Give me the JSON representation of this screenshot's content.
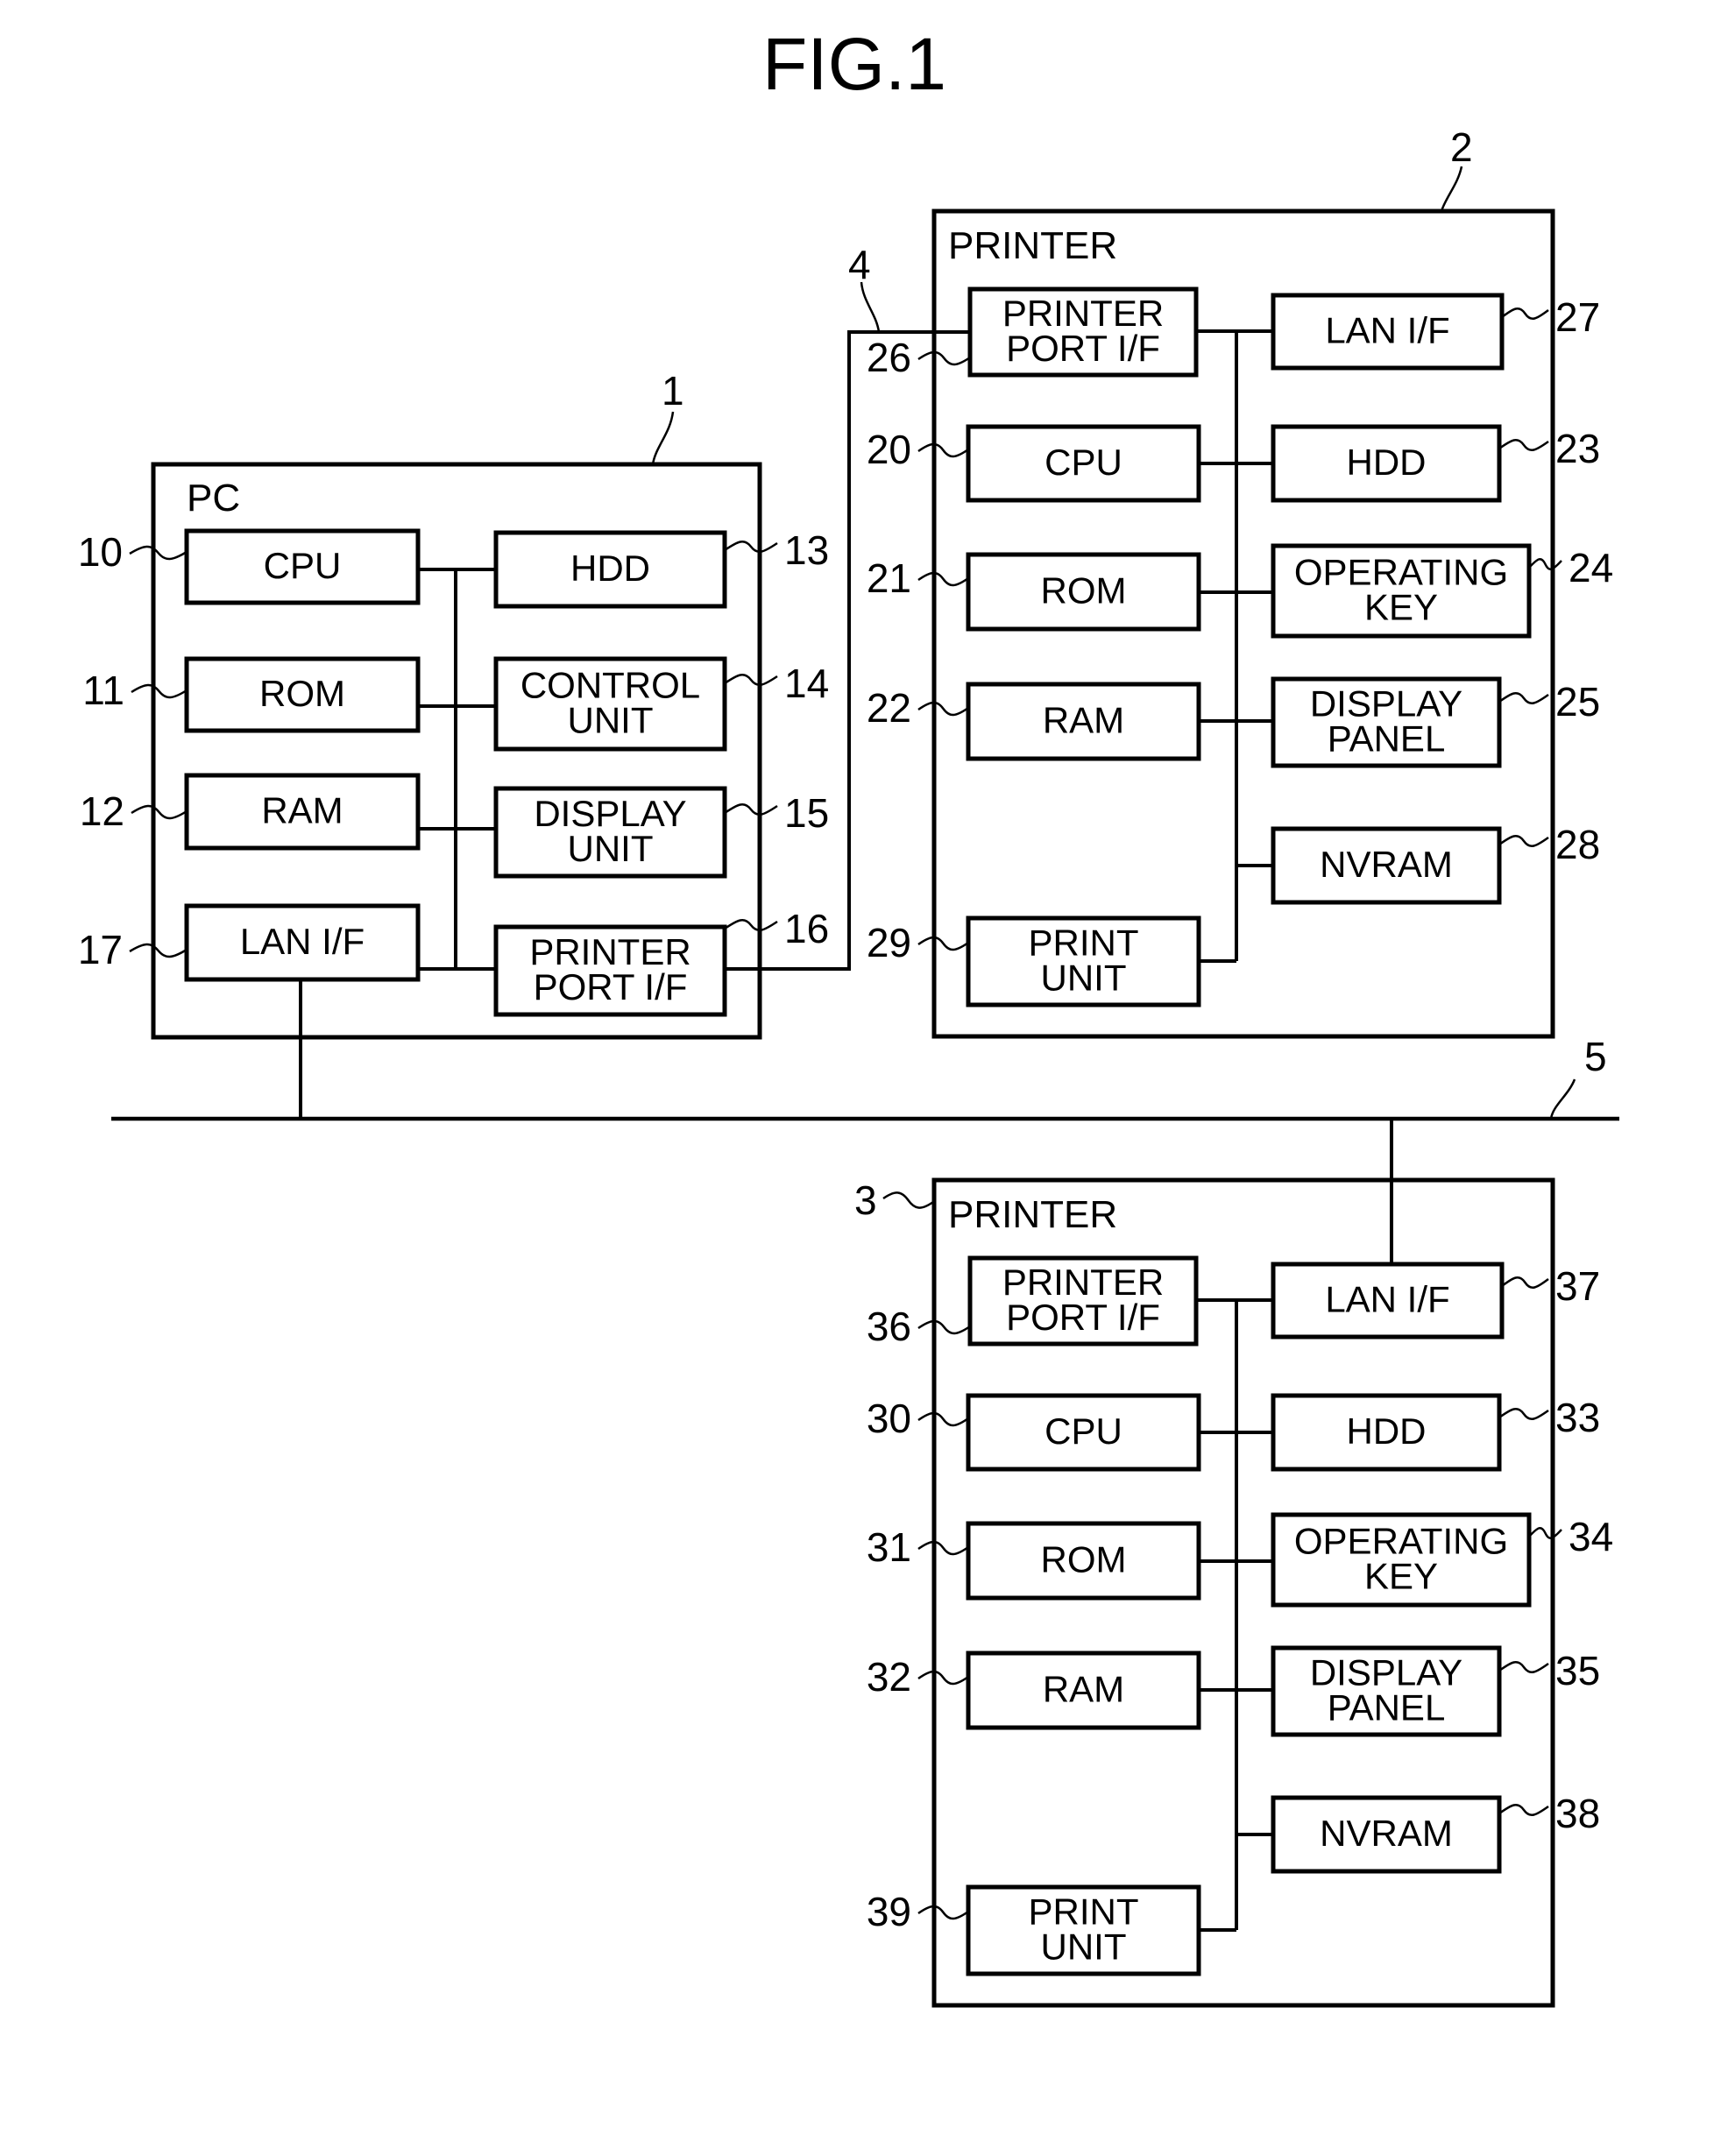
{
  "figure": {
    "title": "FIG.1"
  },
  "pc": {
    "ref": "1",
    "header": "PC",
    "blocks": {
      "cpu": {
        "ref": "10",
        "lines": [
          "CPU"
        ]
      },
      "rom": {
        "ref": "11",
        "lines": [
          "ROM"
        ]
      },
      "ram": {
        "ref": "12",
        "lines": [
          "RAM"
        ]
      },
      "hdd": {
        "ref": "13",
        "lines": [
          "HDD"
        ]
      },
      "control": {
        "ref": "14",
        "lines": [
          "CONTROL",
          "UNIT"
        ]
      },
      "display": {
        "ref": "15",
        "lines": [
          "DISPLAY",
          "UNIT"
        ]
      },
      "port": {
        "ref": "16",
        "lines": [
          "PRINTER",
          "PORT I/F"
        ]
      },
      "lan": {
        "ref": "17",
        "lines": [
          "LAN I/F"
        ]
      }
    }
  },
  "printer_a": {
    "ref": "2",
    "header": "PRINTER",
    "blocks": {
      "port": {
        "ref": "26",
        "lines": [
          "PRINTER",
          "PORT I/F"
        ]
      },
      "cpu": {
        "ref": "20",
        "lines": [
          "CPU"
        ]
      },
      "rom": {
        "ref": "21",
        "lines": [
          "ROM"
        ]
      },
      "ram": {
        "ref": "22",
        "lines": [
          "RAM"
        ]
      },
      "print": {
        "ref": "29",
        "lines": [
          "PRINT",
          "UNIT"
        ]
      },
      "lan": {
        "ref": "27",
        "lines": [
          "LAN I/F"
        ]
      },
      "hdd": {
        "ref": "23",
        "lines": [
          "HDD"
        ]
      },
      "opkey": {
        "ref": "24",
        "lines": [
          "OPERATING",
          "KEY"
        ]
      },
      "panel": {
        "ref": "25",
        "lines": [
          "DISPLAY",
          "PANEL"
        ]
      },
      "nvram": {
        "ref": "28",
        "lines": [
          "NVRAM"
        ]
      }
    }
  },
  "printer_b": {
    "ref": "3",
    "header": "PRINTER",
    "blocks": {
      "port": {
        "ref": "36",
        "lines": [
          "PRINTER",
          "PORT I/F"
        ]
      },
      "cpu": {
        "ref": "30",
        "lines": [
          "CPU"
        ]
      },
      "rom": {
        "ref": "31",
        "lines": [
          "ROM"
        ]
      },
      "ram": {
        "ref": "32",
        "lines": [
          "RAM"
        ]
      },
      "print": {
        "ref": "39",
        "lines": [
          "PRINT",
          "UNIT"
        ]
      },
      "lan": {
        "ref": "37",
        "lines": [
          "LAN I/F"
        ]
      },
      "hdd": {
        "ref": "33",
        "lines": [
          "HDD"
        ]
      },
      "opkey": {
        "ref": "34",
        "lines": [
          "OPERATING",
          "KEY"
        ]
      },
      "panel": {
        "ref": "35",
        "lines": [
          "DISPLAY",
          "PANEL"
        ]
      },
      "nvram": {
        "ref": "38",
        "lines": [
          "NVRAM"
        ]
      }
    }
  },
  "connections": {
    "printer_cable_ref": "4",
    "lan_ref": "5"
  }
}
